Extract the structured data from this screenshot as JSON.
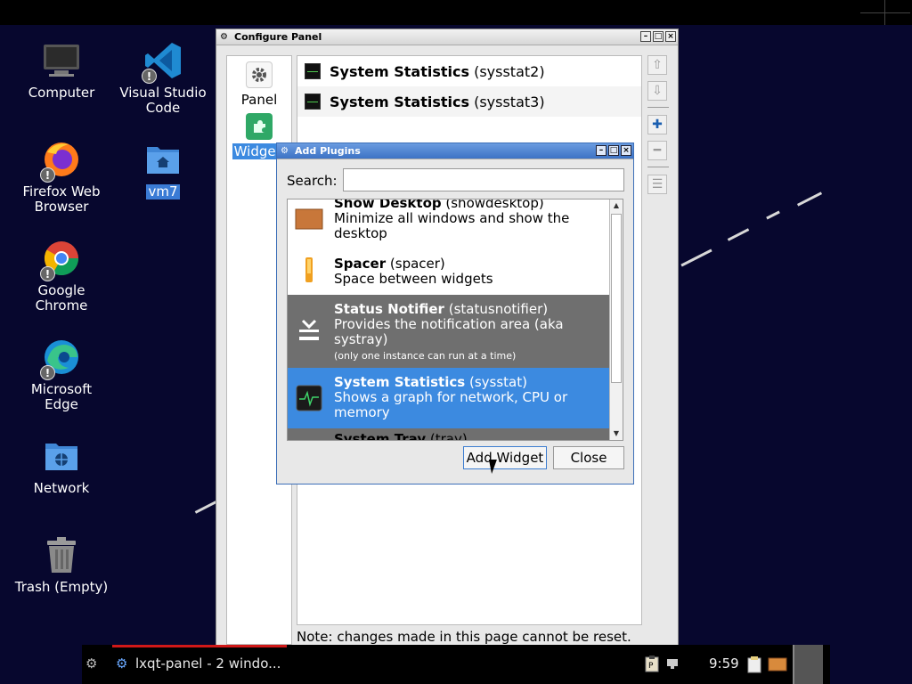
{
  "desktop": {
    "icons": [
      {
        "label": "Computer",
        "icon": "computer-icon",
        "badge": ""
      },
      {
        "label": "Visual Studio Code",
        "icon": "vscode-icon",
        "badge": "!"
      },
      {
        "label": "Firefox Web Browser",
        "icon": "firefox-icon",
        "badge": "!"
      },
      {
        "label": "vm7",
        "icon": "home-folder-icon",
        "badge": ""
      },
      {
        "label": "Google Chrome",
        "icon": "chrome-icon",
        "badge": "!"
      },
      {
        "label": "Microsoft Edge",
        "icon": "edge-icon",
        "badge": "!"
      },
      {
        "label": "Network",
        "icon": "network-folder-icon",
        "badge": ""
      },
      {
        "label": "Trash (Empty)",
        "icon": "trash-icon",
        "badge": ""
      }
    ]
  },
  "configure_panel": {
    "title": "Configure Panel",
    "sidebar": [
      {
        "label": "Panel",
        "icon": "gear-icon"
      },
      {
        "label": "Widgets",
        "icon": "puzzle-icon"
      }
    ],
    "plugins": [
      {
        "name": "System Statistics",
        "id": "(sysstat2)"
      },
      {
        "name": "System Statistics",
        "id": "(sysstat3)"
      }
    ],
    "note": "Note: changes made in this page cannot be reset."
  },
  "add_plugins": {
    "title": "Add Plugins",
    "search_label": "Search:",
    "search_value": "",
    "items": [
      {
        "name": "Show Desktop",
        "id": "(showdesktop)",
        "desc": "Minimize all windows and show the desktop",
        "note": ""
      },
      {
        "name": "Spacer",
        "id": "(spacer)",
        "desc": "Space between widgets",
        "note": ""
      },
      {
        "name": "Status Notifier",
        "id": "(statusnotifier)",
        "desc": "Provides the notification area (aka systray)",
        "note": "(only one instance can run at a time)"
      },
      {
        "name": "System Statistics",
        "id": "(sysstat)",
        "desc": "Shows a graph for network, CPU or memory",
        "note": ""
      },
      {
        "name": "System Tray",
        "id": "(tray)",
        "desc": "",
        "note": ""
      }
    ],
    "add_button": "Add Widget",
    "close_button": "Close"
  },
  "taskbar": {
    "task_label": "lxqt-panel - 2 windo...",
    "clock": "9:59"
  },
  "colors": {
    "desktop_bg": "#07072e",
    "selection": "#3c8ae0",
    "greyed_item": "#6f6f6f"
  }
}
